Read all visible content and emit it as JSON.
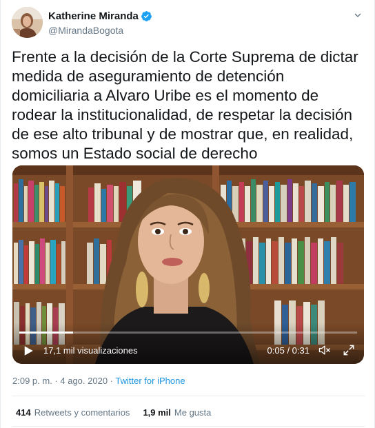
{
  "author": {
    "name": "Katherine Miranda",
    "handle": "@MirandaBogota",
    "verified": true,
    "avatar_icon": "profile-photo"
  },
  "tweet": {
    "text": "Frente a la decisión de la Corte Suprema de dictar medida de aseguramiento de detención domiciliaria a Alvaro Uribe es el momento de rodear la institucionalidad, de respetar la decisión de ese alto tribunal y de mostrar que, en realidad, somos un Estado social de derecho"
  },
  "video": {
    "views": "17,1 mil visualizaciones",
    "time": "0:05 / 0:31",
    "progress": 0.16
  },
  "meta": {
    "time": "2:09 p. m.",
    "separator": " · ",
    "date": "4 ago. 2020",
    "source": "Twitter for iPhone"
  },
  "stats": {
    "retweets_count": "414",
    "retweets_label": "Retweets y comentarios",
    "likes_count": "1,9 mil",
    "likes_label": "Me gusta"
  },
  "colors": {
    "link": "#1b95e0",
    "verified": "#1da1f2",
    "secondary_text": "#657786",
    "primary_text": "#14171a"
  }
}
